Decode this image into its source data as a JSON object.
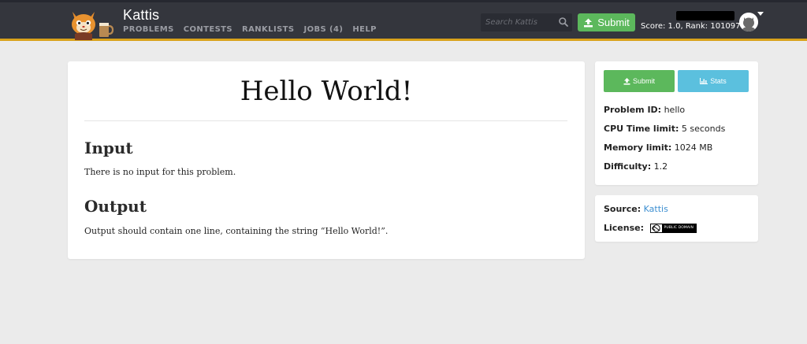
{
  "header": {
    "brand": "Kattis",
    "nav": [
      "PROBLEMS",
      "CONTESTS",
      "RANKLISTS",
      "JOBS (4)",
      "HELP"
    ],
    "search_placeholder": "Search Kattis",
    "submit_label": "Submit",
    "score_text": "Score: 1.0, Rank: 101097",
    "icons": {
      "logo": "kattis-cat-logo",
      "search": "search-icon",
      "upload": "upload-icon",
      "avatar": "user-avatar",
      "caret": "caret-down-icon"
    }
  },
  "problem": {
    "title": "Hello World!",
    "input_heading": "Input",
    "input_text": "There is no input for this problem.",
    "output_heading": "Output",
    "output_text": "Output should contain one line, containing the string “Hello World!”."
  },
  "sidebar": {
    "submit_label": "Submit",
    "stats_label": "Stats",
    "problem_id_label": "Problem ID:",
    "problem_id": "hello",
    "cpu_label": "CPU Time limit:",
    "cpu_value": "5 seconds",
    "memory_label": "Memory limit:",
    "memory_value": "1024 MB",
    "difficulty_label": "Difficulty:",
    "difficulty_value": "1.2",
    "source_label": "Source:",
    "source_value": "Kattis",
    "license_label": "License:",
    "license_badge_text": "PUBLIC DOMAIN"
  },
  "colors": {
    "topbar": "#34363d",
    "accent_line": "#d9a21b",
    "success": "#5cb85c",
    "info": "#5bc0de",
    "link": "#3d8fd1",
    "page_bg": "#ebebeb"
  }
}
